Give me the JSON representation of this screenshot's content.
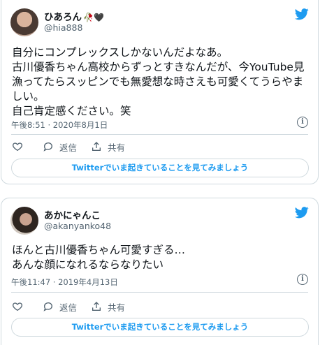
{
  "tweets": [
    {
      "name": "ひあろん",
      "name_emoji": "🥀🖤",
      "handle": "@hia888",
      "text": "自分にコンプレックスしかないんだよなあ。\n古川優香ちゃん高校からずっとすきなんだが、今YouTube見漁ってたらスッピンでも無愛想な時さえも可愛くてうらやましい。\n自己肯定感ください。笑",
      "timestamp": "午後8:51 · 2020年8月1日",
      "like_label": "",
      "reply_label": "返信",
      "share_label": "共有",
      "cta": "Twitterでいま起きていることを見てみましょう"
    },
    {
      "name": "あかにゃんこ",
      "handle": "@akanyanko48",
      "text": "ほんと古川優香ちゃん可愛すぎる…\nあんな顔になれるならなりたい",
      "timestamp": "午後11:47 · 2019年4月13日",
      "like_label": "",
      "reply_label": "返信",
      "share_label": "共有",
      "cta": "Twitterでいま起きていることを見てみましょう"
    }
  ],
  "icons": {
    "bird": "twitter-bird-icon",
    "info": "info-icon",
    "like": "heart-icon",
    "reply": "reply-bubble-icon",
    "share": "share-icon"
  },
  "colors": {
    "brand_blue": "#1d9bf0",
    "text_primary": "#0f1419",
    "text_secondary": "#536471",
    "border": "#cfd9de"
  }
}
